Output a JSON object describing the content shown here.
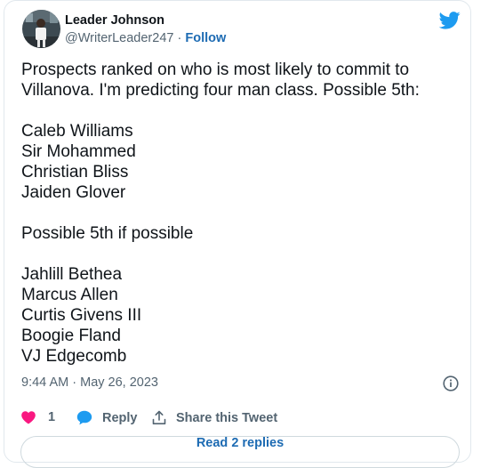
{
  "author": {
    "name": "Leader Johnson",
    "handle": "@WriterLeader247",
    "separator": "·",
    "follow_label": "Follow"
  },
  "tweet": {
    "paragraphs": [
      [
        "Prospects ranked on who is most likely to commit to",
        "Villanova. I'm predicting four man class. Possible 5th:"
      ],
      [
        "Caleb Williams",
        "Sir Mohammed",
        "Christian Bliss",
        "Jaiden Glover"
      ],
      [
        "Possible 5th if possible"
      ],
      [
        "Jahlill Bethea",
        "Marcus Allen",
        "Curtis Givens III",
        "Boogie Fland",
        "VJ Edgecomb"
      ]
    ],
    "time": "9:44 AM",
    "date_separator": "·",
    "date": "May 26, 2023"
  },
  "actions": {
    "like_count": "1",
    "reply_label": "Reply",
    "share_label": "Share this Tweet"
  },
  "footer": {
    "read_replies_label": "Read 2 replies"
  },
  "colors": {
    "twitter_blue": "#1d9bf0",
    "like_pink": "#f91880",
    "text_primary": "#0f1419",
    "text_secondary": "#536471"
  },
  "icons": {
    "brand": "twitter-bird-icon",
    "info": "info-icon",
    "like": "heart-icon",
    "reply": "reply-bubble-icon",
    "share": "share-icon"
  }
}
